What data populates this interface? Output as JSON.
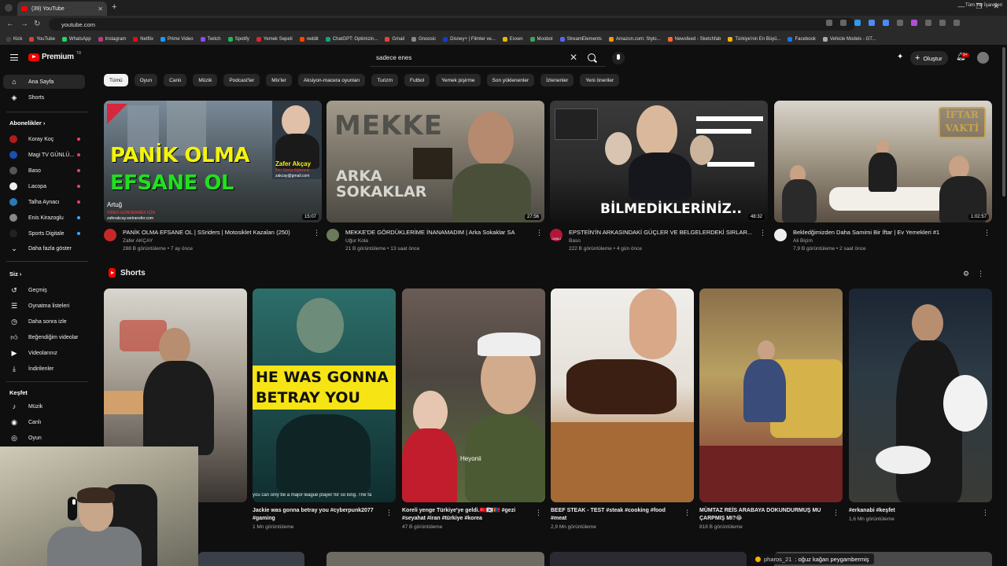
{
  "browser": {
    "tab_title": "(39) YouTube",
    "url": "youtube.com",
    "bookmarks": [
      "Kick",
      "YouTube",
      "WhatsApp",
      "Instagram",
      "Netflix",
      "Prime Video",
      "Twitch",
      "Spotify",
      "Yemek Sepeti",
      "reddit",
      "ChatGPT: Optimizin...",
      "Gmail",
      "Gnoosic",
      "Disney+ | Filmler ve...",
      "Exxen",
      "Moobot",
      "StreamElements",
      "Amazon.com: Stylo...",
      "Newsfeed - Sketchfab",
      "Türkiye'nin En Büyü...",
      "Facebook",
      "Vehicle Models - GT..."
    ],
    "bookmarks_right": "Tüm Yer İşaretleri"
  },
  "header": {
    "logo_text": "Premium",
    "logo_region": "TR",
    "search_value": "sadece enes",
    "create_label": "Oluştur",
    "notif_count": "9+"
  },
  "sidebar": {
    "home": "Ana Sayfa",
    "shorts": "Shorts",
    "subs_header": "Abonelikler",
    "subs": [
      "Koray Koç",
      "Magi TV GÜNLÜ...",
      "Baso",
      "Lacopa",
      "Talha Aynacı",
      "Enis Kirazoglu",
      "Sports Digitale"
    ],
    "show_more": "Daha fazla göster",
    "you_header": "Siz",
    "you_items": [
      "Geçmiş",
      "Oynatma listeleri",
      "Daha sonra izle",
      "Beğendiğim videolar",
      "Videolarınız",
      "İndirilenler"
    ],
    "explore_header": "Keşfet",
    "explore_items": [
      "Müzik",
      "Canlı",
      "Oyun"
    ]
  },
  "chips": [
    "Tümü",
    "Oyun",
    "Canlı",
    "Müzik",
    "Podcast'ler",
    "Mix'ler",
    "Aksiyon-macera oyunları",
    "Turizm",
    "Futbol",
    "Yemek pişirme",
    "Son yüklenenler",
    "İzlenenler",
    "Yeni öneriler"
  ],
  "videos": [
    {
      "title": "PANİK OLMA EFSANE OL | SSriders | Motosiklet Kazaları (250)",
      "channel": "Zafer AKÇAY",
      "stats": "288 B görüntüleme • 7 ay önce",
      "duration": "15:07",
      "thumb_line1": "PANİK OLMA",
      "thumb_line2": "EFSANE OL",
      "thumb_name": "Zafer Akçay",
      "thumb_sub": "İleri Sürüş Eğitmeni",
      "thumb_mail": "zakcay@gmail.com",
      "thumb_artug": "Artuğ",
      "thumb_footer": "VİDEO GÖNDERMEK İÇİN",
      "thumb_footer2": "zaferakcay.wetransfer.com"
    },
    {
      "title": "MEKKE'DE GÖRDÜKLERİME İNANAMADIM | Arka Sokaklar SA",
      "channel": "Uğur Kola",
      "stats": "21 B görüntüleme • 13 saat önce",
      "duration": "27:56",
      "thumb_line1": "MEKKE",
      "thumb_line2": "ARKA",
      "thumb_line3": "SOKAKLAR"
    },
    {
      "title": "EPSTEİN'İN ARKASINDAKİ GÜÇLER VE BELGELERDEKİ SIRLAR...",
      "channel": "Baso",
      "stats": "222 B görüntüleme • 4 gün önce",
      "duration": "48:32",
      "thumb_line1": "BİLMEDİKLERİNİZ..",
      "avatar_label": "CANLI"
    },
    {
      "title": "Bekledğimizden Daha Samimi Bir İftar | Ev Yemekleri #1",
      "channel": "Ali Biçim",
      "stats": "7,9 B görüntüleme • 2 saat önce",
      "duration": "1:02:57",
      "thumb_line1": "İFTAR",
      "thumb_line2": "VAKTİ"
    }
  ],
  "shorts": {
    "title": "Shorts",
    "items": [
      {
        "title": "",
        "stats": ""
      },
      {
        "title": "Jackie was gonna betray you #cyberpunk2077 #gaming",
        "stats": "1 Mn görüntüleme",
        "overlay": "HE WAS GONNA BETRAY YOU",
        "caption": "you can only be a major league player for so long. The fa"
      },
      {
        "title": "Koreli yenge Türkiye'ye geldi.🇹🇷🇰🇷🇲🇳 #gezi #seyahat #iran #türkiye #korea",
        "stats": "47 B görüntüleme",
        "overlay": "Heyonii"
      },
      {
        "title": "BEEF STEAK - TEST #steak #cooking #food #meat",
        "stats": "2,9 Mn görüntüleme"
      },
      {
        "title": "MÜMTAZ REİS ARABAYA DOKUNDURMUŞ MU ÇARPMIŞ MI?😂",
        "stats": "818 B görüntüleme"
      },
      {
        "title": "#erkanabi #keşfet",
        "stats": "1,6 Mn görüntüleme"
      }
    ]
  },
  "chat": {
    "user": "pharos_21",
    "message": ": oğuz kağan peygambermiş"
  },
  "colors": {
    "background": "#0f0f0f",
    "brand_red": "#ff0000",
    "chip_bg": "#272727",
    "chip_selected_bg": "#f1f1f1"
  }
}
